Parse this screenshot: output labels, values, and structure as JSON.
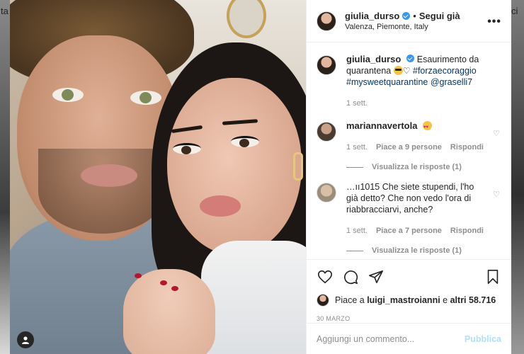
{
  "background": {
    "left_fragment": "ta",
    "right_fragment": "ci"
  },
  "post": {
    "username": "giulia_durso",
    "follow_label": "Segui già",
    "separator": "•",
    "location": "Valenza, Piemonte, Italy",
    "more_label": "•••"
  },
  "caption": {
    "username": "giulia_durso",
    "text_before": "Esaurimento da quarantena",
    "hashtag1": "#forzaecoraggio",
    "hashtag2": "#mysweetquarantine",
    "mention": "@graselli7",
    "time": "1 sett."
  },
  "comments": [
    {
      "username": "mariannavertola",
      "text": "",
      "time": "1 sett.",
      "likes": "Piace a 9 persone",
      "reply": "Rispondi",
      "replies_label": "Visualizza le risposte (1)"
    },
    {
      "username": "",
      "text": "…ıı1015 Che siete stupendi, l'ho già detto? Che non vedo l'ora di riabbracciarvi, anche?",
      "time": "1 sett.",
      "likes": "Piace a 7 persone",
      "reply": "Rispondi",
      "replies_label": "Visualizza le risposte (1)"
    }
  ],
  "actions": {
    "likes_prefix": "Piace a",
    "likes_user": "luigi_mastroianni",
    "likes_middle": "e",
    "likes_others": "altri 58.716",
    "date": "30 MARZO"
  },
  "add_comment": {
    "placeholder": "Aggiungi un commento...",
    "publish_label": "Pubblica"
  },
  "colors": {
    "link": "#00376b",
    "verified": "#3897f0",
    "publish_disabled": "#b2dffc",
    "meta": "#8e8e8e"
  }
}
